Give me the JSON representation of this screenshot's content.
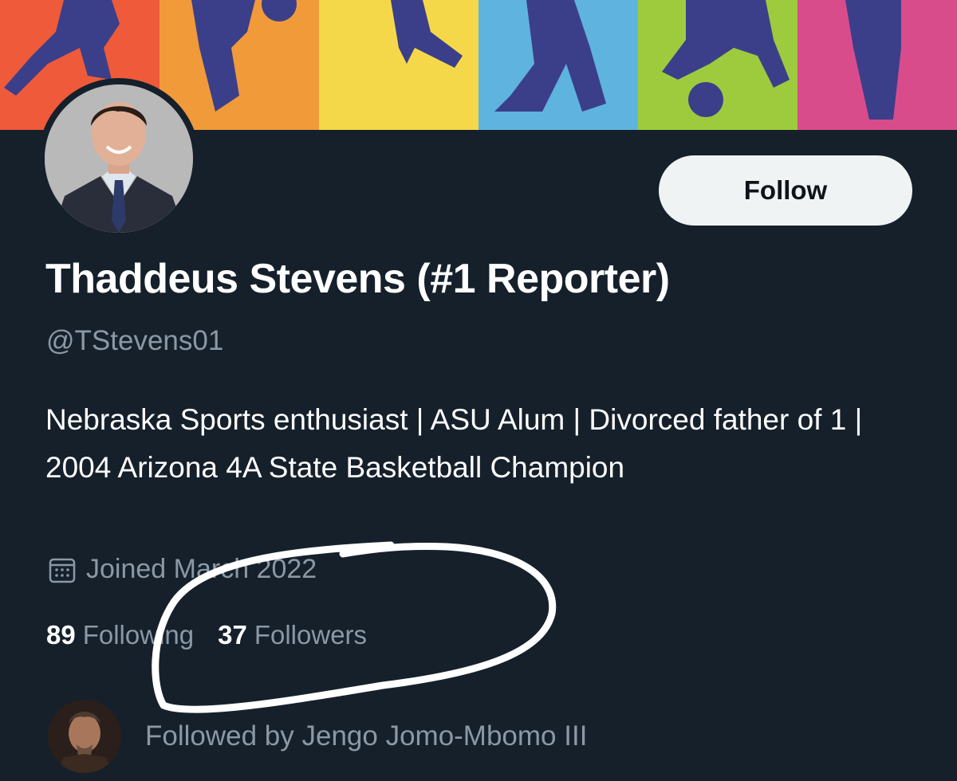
{
  "banner": {
    "icon": "basketball-players-banner",
    "panel_colors": [
      "#ee5a3a",
      "#f09a3a",
      "#f5d84a",
      "#5fb3df",
      "#9ecb3e",
      "#d94c8c"
    ],
    "silhouette_color": "#3b3f8a"
  },
  "profile": {
    "display_name": "Thaddeus Stevens (#1 Reporter)",
    "handle": "@TStevens01",
    "bio": "Nebraska Sports enthusiast | ASU Alum | Divorced father of 1 | 2004 Arizona 4A State Basketball Champion",
    "joined_icon": "calendar-icon",
    "joined_text": "Joined March 2022"
  },
  "actions": {
    "follow_label": "Follow"
  },
  "stats": {
    "following_count": "89",
    "following_label": "Following",
    "followers_count": "37",
    "followers_label": "Followers"
  },
  "followed_by": {
    "text": "Followed by Jengo Jomo-Mbomo III"
  },
  "colors": {
    "background": "#15202b",
    "primary_text": "#ffffff",
    "secondary_text": "#8b98a5",
    "button_bg": "#eff3f4"
  }
}
